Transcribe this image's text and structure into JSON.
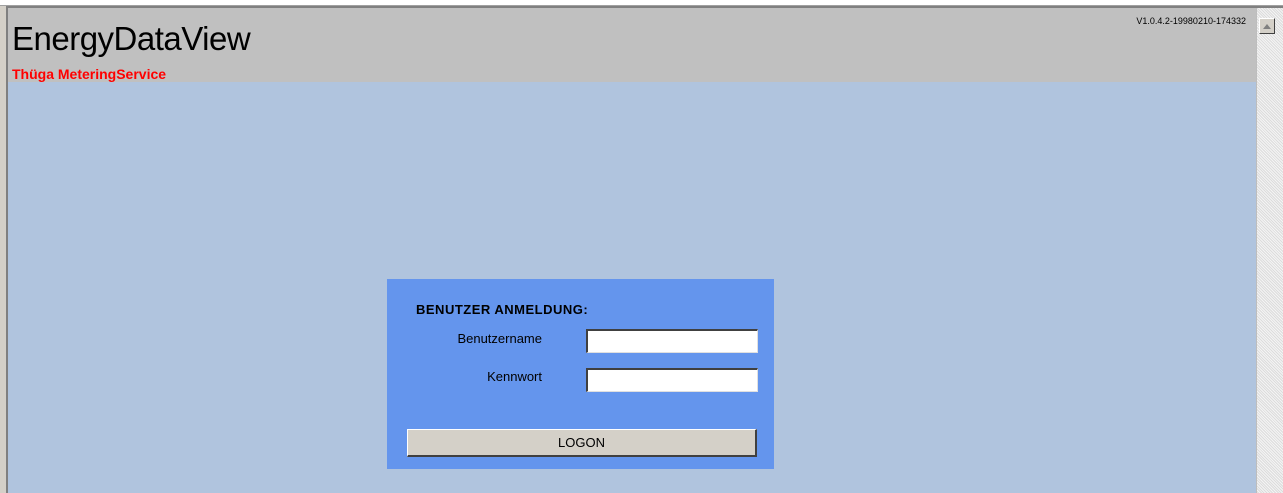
{
  "header": {
    "title": "EnergyDataView",
    "subtitle": "Thüga MeteringService",
    "version": "V1.0.4.2-19980210-174332"
  },
  "login": {
    "title": "BENUTZER  ANMELDUNG:",
    "username_label": "Benutzername",
    "username_value": "",
    "password_label": "Kennwort",
    "password_value": "",
    "logon_label": "LOGON"
  },
  "icons": {
    "scroll_up": "triangle-up-icon"
  },
  "colors": {
    "page_background": "#b0c4de",
    "header_background": "#c0c0c0",
    "subtitle": "#ff0000",
    "login_panel": "#6495ed",
    "button": "#d4d0c8"
  }
}
